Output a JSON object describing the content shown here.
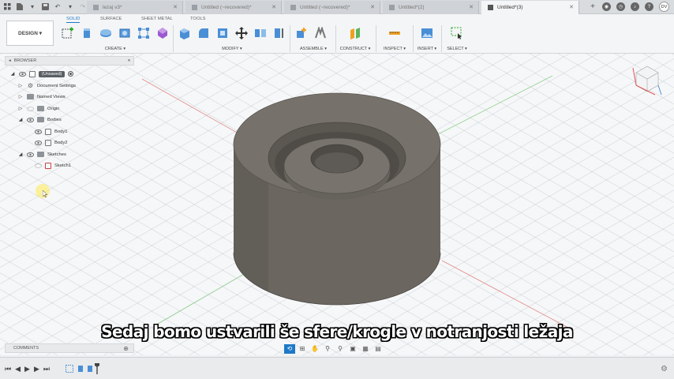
{
  "tabs": [
    {
      "label": "lezaj v3*",
      "active": false
    },
    {
      "label": "Untitled (~recovered)*",
      "active": false
    },
    {
      "label": "Untitled (~recovered)*",
      "active": false
    },
    {
      "label": "Untitled*(2)",
      "active": false
    },
    {
      "label": "Untitled*(3)",
      "active": true
    }
  ],
  "user_initials": "DV",
  "toolbar": {
    "design_label": "DESIGN ▾",
    "workspaces": [
      "SOLID",
      "SURFACE",
      "SHEET METAL",
      "TOOLS"
    ],
    "groups": [
      "CREATE ▾",
      "MODIFY ▾",
      "ASSEMBLE ▾",
      "CONSTRUCT ▾",
      "INSPECT ▾",
      "INSERT ▾",
      "SELECT ▾"
    ]
  },
  "browser": {
    "header": "BROWSER",
    "root_label": "(Unsaved)",
    "items": [
      {
        "label": "Document Settings"
      },
      {
        "label": "Named Views"
      },
      {
        "label": "Origin"
      },
      {
        "label": "Bodies"
      },
      {
        "label": "Body1"
      },
      {
        "label": "Body2"
      },
      {
        "label": "Sketches"
      },
      {
        "label": "Sketch1"
      }
    ]
  },
  "comments_label": "COMMENTS",
  "subtitle": "Sedaj bomo ustvarili še sfere/krogle v notranjosti ležaja",
  "colors": {
    "accent": "#1d79c7",
    "model_body": "#6b6760",
    "model_top": "#76726b",
    "model_dark": "#524f4a"
  },
  "icons": {
    "app_grid": "grid-icon",
    "file": "file-icon",
    "save": "save-icon",
    "undo": "undo-icon",
    "redo": "redo-icon",
    "view_cube": "view-cube-icon"
  }
}
